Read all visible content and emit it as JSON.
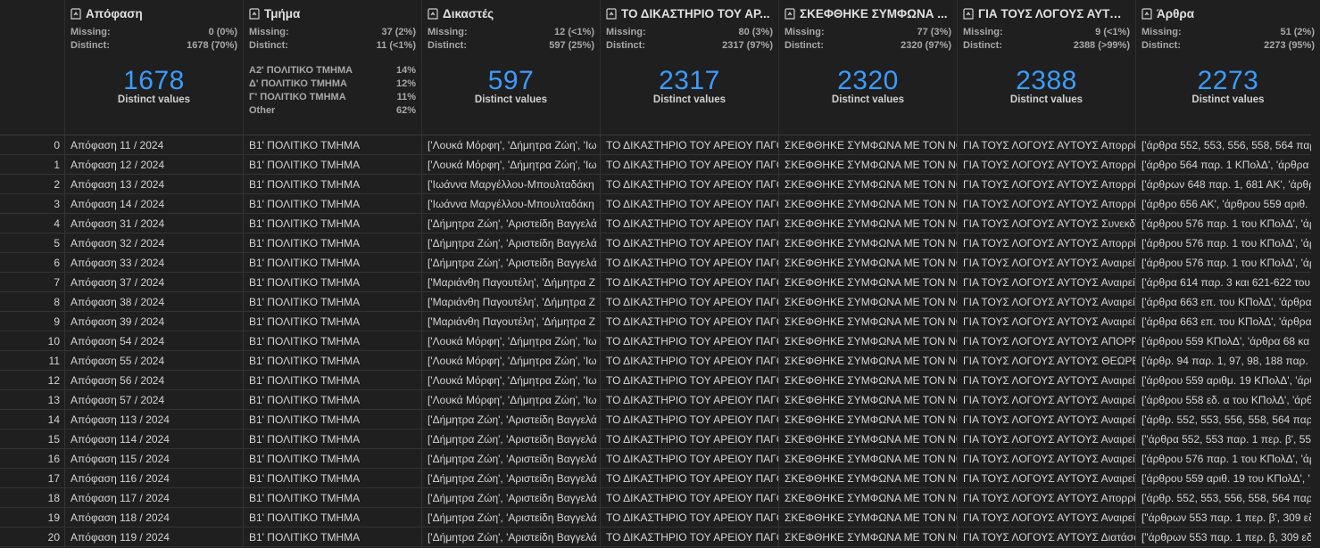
{
  "columns": [
    {
      "name": "Απόφαση",
      "icon": "text-type-icon",
      "missing_label": "Missing:",
      "missing_value": "0 (0%)",
      "distinct_label": "Distinct:",
      "distinct_value": "1678 (70%)",
      "summary_type": "distinct",
      "distinct_count": "1678",
      "distinct_caption": "Distinct values"
    },
    {
      "name": "Τμήμα",
      "icon": "text-type-icon",
      "missing_label": "Missing:",
      "missing_value": "37 (2%)",
      "distinct_label": "Distinct:",
      "distinct_value": "11 (<1%)",
      "summary_type": "categories",
      "categories": [
        {
          "label": "Α2' ΠΟΛΙΤΙΚΟ ΤΜΗΜΑ",
          "pct": "14%"
        },
        {
          "label": "Δ' ΠΟΛΙΤΙΚΟ ΤΜΗΜΑ",
          "pct": "12%"
        },
        {
          "label": "Γ' ΠΟΛΙΤΙΚΟ ΤΜΗΜΑ",
          "pct": "11%"
        },
        {
          "label": "Other",
          "pct": "62%"
        }
      ]
    },
    {
      "name": "Δικαστές",
      "icon": "text-type-icon",
      "missing_label": "Missing:",
      "missing_value": "12 (<1%)",
      "distinct_label": "Distinct:",
      "distinct_value": "597 (25%)",
      "summary_type": "distinct",
      "distinct_count": "597",
      "distinct_caption": "Distinct values"
    },
    {
      "name": "ΤΟ ΔΙΚΑΣΤΗΡΙΟ ΤΟΥ ΑΡ...",
      "icon": "text-type-icon",
      "missing_label": "Missing:",
      "missing_value": "80 (3%)",
      "distinct_label": "Distinct:",
      "distinct_value": "2317 (97%)",
      "summary_type": "distinct",
      "distinct_count": "2317",
      "distinct_caption": "Distinct values"
    },
    {
      "name": "ΣΚΕΦΘΗΚΕ ΣΥΜΦΩΝΑ ...",
      "icon": "text-type-icon",
      "missing_label": "Missing:",
      "missing_value": "77 (3%)",
      "distinct_label": "Distinct:",
      "distinct_value": "2320 (97%)",
      "summary_type": "distinct",
      "distinct_count": "2320",
      "distinct_caption": "Distinct values"
    },
    {
      "name": "ΓΙΑ ΤΟΥΣ ΛΟΓΟΥΣ ΑΥΤΟΥΣ",
      "icon": "text-type-icon",
      "missing_label": "Missing:",
      "missing_value": "9 (<1%)",
      "distinct_label": "Distinct:",
      "distinct_value": "2388 (>99%)",
      "summary_type": "distinct",
      "distinct_count": "2388",
      "distinct_caption": "Distinct values"
    },
    {
      "name": "Άρθρα",
      "icon": "text-type-icon",
      "missing_label": "Missing:",
      "missing_value": "51 (2%)",
      "distinct_label": "Distinct:",
      "distinct_value": "2273 (95%)",
      "summary_type": "distinct",
      "distinct_count": "2273",
      "distinct_caption": "Distinct values"
    }
  ],
  "rows": [
    {
      "idx": "0",
      "c": [
        "Απόφαση 11 / 2024",
        "Β1' ΠΟΛΙΤΙΚΟ ΤΜΗΜΑ",
        "['Λουκά Μόρφη', 'Δήμητρα Ζώη', 'Ιω",
        "ΤΟ ΔΙΚΑΣΤΗΡΙΟ ΤΟΥ ΑΡΕΙΟΥ ΠΑΓΟΥ",
        "ΣΚΕΦΘΗΚΕ ΣΥΜΦΩΝΑ ΜΕ ΤΟΝ ΝΟΜ",
        "ΓΙΑ ΤΟΥΣ ΛΟΓΟΥΣ ΑΥΤΟΥΣ Απορρίπ",
        "['άρθρα 552, 553, 556, 558, 564 παρ"
      ]
    },
    {
      "idx": "1",
      "c": [
        "Απόφαση 12 / 2024",
        "Β1' ΠΟΛΙΤΙΚΟ ΤΜΗΜΑ",
        "['Λουκά Μόρφη', 'Δήμητρα Ζώη', 'Ιω",
        "ΤΟ ΔΙΚΑΣΤΗΡΙΟ ΤΟΥ ΑΡΕΙΟΥ ΠΑΓΟΥ",
        "ΣΚΕΦΘΗΚΕ ΣΥΜΦΩΝΑ ΜΕ ΤΟΝ ΝΟΜ",
        "ΓΙΑ ΤΟΥΣ ΛΟΓΟΥΣ ΑΥΤΟΥΣ Απορρίπ",
        "['άρθρο 564 παρ. 1 ΚΠολΔ', 'άρθρα"
      ]
    },
    {
      "idx": "2",
      "c": [
        "Απόφαση 13 / 2024",
        "Β1' ΠΟΛΙΤΙΚΟ ΤΜΗΜΑ",
        "['Ιωάννα Μαργέλλου-Μπουλταδάκη",
        "ΤΟ ΔΙΚΑΣΤΗΡΙΟ ΤΟΥ ΑΡΕΙΟΥ ΠΑΓΟΥ",
        "ΣΚΕΦΘΗΚΕ ΣΥΜΦΩΝΑ ΜΕ ΤΟΝ ΝΟΜ",
        "ΓΙΑ ΤΟΥΣ ΛΟΓΟΥΣ ΑΥΤΟΥΣ Απορρίπ",
        "['άρθρων 648 παρ. 1, 681 ΑΚ', 'άρθρ"
      ]
    },
    {
      "idx": "3",
      "c": [
        "Απόφαση 14 / 2024",
        "Β1' ΠΟΛΙΤΙΚΟ ΤΜΗΜΑ",
        "['Ιωάννα Μαργέλλου-Μπουλταδάκη",
        "ΤΟ ΔΙΚΑΣΤΗΡΙΟ ΤΟΥ ΑΡΕΙΟΥ ΠΑΓΟΥ",
        "ΣΚΕΦΘΗΚΕ ΣΥΜΦΩΝΑ ΜΕ ΤΟΝ ΝΟΜ",
        "ΓΙΑ ΤΟΥΣ ΛΟΓΟΥΣ ΑΥΤΟΥΣ Απορρίπ",
        "['άρθρο 656 ΑΚ', 'άρθρου 559 αριθ."
      ]
    },
    {
      "idx": "4",
      "c": [
        "Απόφαση 31 / 2024",
        "Β1' ΠΟΛΙΤΙΚΟ ΤΜΗΜΑ",
        "['Δήμητρα Ζώη', 'Αριστείδη Βαγγελά",
        "ΤΟ ΔΙΚΑΣΤΗΡΙΟ ΤΟΥ ΑΡΕΙΟΥ ΠΑΓΟΥ",
        "ΣΚΕΦΘΗΚΕ ΣΥΜΦΩΝΑ ΜΕ ΤΟΝ ΝΟΜ",
        "ΓΙΑ ΤΟΥΣ ΛΟΓΟΥΣ ΑΥΤΟΥΣ Συνεκδικ",
        "['άρθρου 576 παρ. 1 του ΚΠολΔ', 'άρ"
      ]
    },
    {
      "idx": "5",
      "c": [
        "Απόφαση 32 / 2024",
        "Β1' ΠΟΛΙΤΙΚΟ ΤΜΗΜΑ",
        "['Δήμητρα Ζώη', 'Αριστείδη Βαγγελά",
        "ΤΟ ΔΙΚΑΣΤΗΡΙΟ ΤΟΥ ΑΡΕΙΟΥ ΠΑΓΟΥ",
        "ΣΚΕΦΘΗΚΕ ΣΥΜΦΩΝΑ ΜΕ ΤΟΝ ΝΟΜ",
        "ΓΙΑ ΤΟΥΣ ΛΟΓΟΥΣ ΑΥΤΟΥΣ Απορρίπ",
        "['άρθρου 576 παρ. 1 του ΚΠολΔ', 'άρ"
      ]
    },
    {
      "idx": "6",
      "c": [
        "Απόφαση 33 / 2024",
        "Β1' ΠΟΛΙΤΙΚΟ ΤΜΗΜΑ",
        "['Δήμητρα Ζώη', 'Αριστείδη Βαγγελά",
        "ΤΟ ΔΙΚΑΣΤΗΡΙΟ ΤΟΥ ΑΡΕΙΟΥ ΠΑΓΟΥ",
        "ΣΚΕΦΘΗΚΕ ΣΥΜΦΩΝΑ ΜΕ ΤΟΝ ΝΟΜ",
        "ΓΙΑ ΤΟΥΣ ΛΟΓΟΥΣ ΑΥΤΟΥΣ Αναιρεί τ",
        "['άρθρου 576 παρ. 1 του ΚΠολΔ', 'άρ"
      ]
    },
    {
      "idx": "7",
      "c": [
        "Απόφαση 37 / 2024",
        "Β1' ΠΟΛΙΤΙΚΟ ΤΜΗΜΑ",
        "['Μαριάνθη Παγουτέλη', 'Δήμητρα Ζ",
        "ΤΟ ΔΙΚΑΣΤΗΡΙΟ ΤΟΥ ΑΡΕΙΟΥ ΠΑΓΟΥ",
        "ΣΚΕΦΘΗΚΕ ΣΥΜΦΩΝΑ ΜΕ ΤΟΝ ΝΟΜ",
        "ΓΙΑ ΤΟΥΣ ΛΟΓΟΥΣ ΑΥΤΟΥΣ Αναιρεί τ",
        "['άρθρα 614 παρ. 3 και 621-622 του"
      ]
    },
    {
      "idx": "8",
      "c": [
        "Απόφαση 38 / 2024",
        "Β1' ΠΟΛΙΤΙΚΟ ΤΜΗΜΑ",
        "['Μαριάνθη Παγουτέλη', 'Δήμητρα Ζ",
        "ΤΟ ΔΙΚΑΣΤΗΡΙΟ ΤΟΥ ΑΡΕΙΟΥ ΠΑΓΟΥ",
        "ΣΚΕΦΘΗΚΕ ΣΥΜΦΩΝΑ ΜΕ ΤΟΝ ΝΟΜ",
        "ΓΙΑ ΤΟΥΣ ΛΟΓΟΥΣ ΑΥΤΟΥΣ Αναιρεί, ε",
        "['άρθρα 663 επ. του ΚΠολΔ', 'άρθρα"
      ]
    },
    {
      "idx": "9",
      "c": [
        "Απόφαση 39 / 2024",
        "Β1' ΠΟΛΙΤΙΚΟ ΤΜΗΜΑ",
        "['Μαριάνθη Παγουτέλη', 'Δήμητρα Ζ",
        "ΤΟ ΔΙΚΑΣΤΗΡΙΟ ΤΟΥ ΑΡΕΙΟΥ ΠΑΓΟΥ",
        "ΣΚΕΦΘΗΚΕ ΣΥΜΦΩΝΑ ΜΕ ΤΟΝ ΝΟΜ",
        "ΓΙΑ ΤΟΥΣ ΛΟΓΟΥΣ ΑΥΤΟΥΣ Αναιρεί, ε",
        "['άρθρα 663 επ. του ΚΠολΔ', 'άρθρα"
      ]
    },
    {
      "idx": "10",
      "c": [
        "Απόφαση 54 / 2024",
        "Β1' ΠΟΛΙΤΙΚΟ ΤΜΗΜΑ",
        "['Λουκά Μόρφη', 'Δήμητρα Ζώη', 'Ιω",
        "ΤΟ ΔΙΚΑΣΤΗΡΙΟ ΤΟΥ ΑΡΕΙΟΥ ΠΑΓΟΥ",
        "ΣΚΕΦΘΗΚΕ ΣΥΜΦΩΝΑ ΜΕ ΤΟΝ ΝΟΜ",
        "ΓΙΑ ΤΟΥΣ ΛΟΓΟΥΣ ΑΥΤΟΥΣ ΑΠΟΡΡΙΠ",
        "['άρθρου 559 ΚΠολΔ', 'άρθρα 68 κα"
      ]
    },
    {
      "idx": "11",
      "c": [
        "Απόφαση 55 / 2024",
        "Β1' ΠΟΛΙΤΙΚΟ ΤΜΗΜΑ",
        "['Λουκά Μόρφη', 'Δήμητρα Ζώη', 'Ιω",
        "ΤΟ ΔΙΚΑΣΤΗΡΙΟ ΤΟΥ ΑΡΕΙΟΥ ΠΑΓΟΥ",
        "ΣΚΕΦΘΗΚΕ ΣΥΜΦΩΝΑ ΜΕ ΤΟΝ ΝΟΜ",
        "ΓΙΑ ΤΟΥΣ ΛΟΓΟΥΣ ΑΥΤΟΥΣ ΘΕΩΡΕΙ α",
        "['άρθρ. 94 παρ. 1, 97, 98, 188 παρ. 1"
      ]
    },
    {
      "idx": "12",
      "c": [
        "Απόφαση 56 / 2024",
        "Β1' ΠΟΛΙΤΙΚΟ ΤΜΗΜΑ",
        "['Λουκά Μόρφη', 'Δήμητρα Ζώη', 'Ιω",
        "ΤΟ ΔΙΚΑΣΤΗΡΙΟ ΤΟΥ ΑΡΕΙΟΥ ΠΑΓΟΥ",
        "ΣΚΕΦΘΗΚΕ ΣΥΜΦΩΝΑ ΜΕ ΤΟΝ ΝΟΜ",
        "ΓΙΑ ΤΟΥΣ ΛΟΓΟΥΣ ΑΥΤΟΥΣ Αναιρεί α",
        "['άρθρου 559 αριθμ. 19 ΚΠολΔ', 'άρθ"
      ]
    },
    {
      "idx": "13",
      "c": [
        "Απόφαση 57 / 2024",
        "Β1' ΠΟΛΙΤΙΚΟ ΤΜΗΜΑ",
        "['Λουκά Μόρφη', 'Δήμητρα Ζώη', 'Ιω",
        "ΤΟ ΔΙΚΑΣΤΗΡΙΟ ΤΟΥ ΑΡΕΙΟΥ ΠΑΓΟΥ",
        "ΣΚΕΦΘΗΚΕ ΣΥΜΦΩΝΑ ΜΕ ΤΟΝ ΝΟΜ",
        "ΓΙΑ ΤΟΥΣ ΛΟΓΟΥΣ ΑΥΤΟΥΣ Αναιρεί τ",
        "['άρθρου 558 εδ. α του ΚΠολΔ', 'άρθ"
      ]
    },
    {
      "idx": "14",
      "c": [
        "Απόφαση 113 / 2024",
        "Β1' ΠΟΛΙΤΙΚΟ ΤΜΗΜΑ",
        "['Δήμητρα Ζώη', 'Αριστείδη Βαγγελά",
        "ΤΟ ΔΙΚΑΣΤΗΡΙΟ ΤΟΥ ΑΡΕΙΟΥ ΠΑΓΟΥ",
        "ΣΚΕΦΘΗΚΕ ΣΥΜΦΩΝΑ ΜΕ ΤΟΝ ΝΟΜ",
        "ΓΙΑ ΤΟΥΣ ΛΟΓΟΥΣ ΑΥΤΟΥΣ Αναιρεί τ",
        "['άρθρ. 552, 553, 556, 558, 564 παρ."
      ]
    },
    {
      "idx": "15",
      "c": [
        "Απόφαση 114 / 2024",
        "Β1' ΠΟΛΙΤΙΚΟ ΤΜΗΜΑ",
        "['Δήμητρα Ζώη', 'Αριστείδη Βαγγελά",
        "ΤΟ ΔΙΚΑΣΤΗΡΙΟ ΤΟΥ ΑΡΕΙΟΥ ΠΑΓΟΥ",
        "ΣΚΕΦΘΗΚΕ ΣΥΜΦΩΝΑ ΜΕ ΤΟΝ ΝΟΜ",
        "ΓΙΑ ΤΟΥΣ ΛΟΓΟΥΣ ΑΥΤΟΥΣ Αναιρεί τ",
        "[\"άρθρα 552, 553 παρ. 1 περ. β', 559"
      ]
    },
    {
      "idx": "16",
      "c": [
        "Απόφαση 115 / 2024",
        "Β1' ΠΟΛΙΤΙΚΟ ΤΜΗΜΑ",
        "['Δήμητρα Ζώη', 'Αριστείδη Βαγγελά",
        "ΤΟ ΔΙΚΑΣΤΗΡΙΟ ΤΟΥ ΑΡΕΙΟΥ ΠΑΓΟΥ",
        "ΣΚΕΦΘΗΚΕ ΣΥΜΦΩΝΑ ΜΕ ΤΟΝ ΝΟΜ",
        "ΓΙΑ ΤΟΥΣ ΛΟΓΟΥΣ ΑΥΤΟΥΣ Αναιρεί τ",
        "['άρθρου 576 παρ. 1 του ΚΠολΔ', 'άρ"
      ]
    },
    {
      "idx": "17",
      "c": [
        "Απόφαση 116 / 2024",
        "Β1' ΠΟΛΙΤΙΚΟ ΤΜΗΜΑ",
        "['Δήμητρα Ζώη', 'Αριστείδη Βαγγελά",
        "ΤΟ ΔΙΚΑΣΤΗΡΙΟ ΤΟΥ ΑΡΕΙΟΥ ΠΑΓΟΥ",
        "ΣΚΕΦΘΗΚΕ ΣΥΜΦΩΝΑ ΜΕ ΤΟΝ ΝΟΜ",
        "ΓΙΑ ΤΟΥΣ ΛΟΓΟΥΣ ΑΥΤΟΥΣ Αναιρεί τ",
        "['άρθρου 559 αριθ. 19 του ΚΠολΔ', '"
      ]
    },
    {
      "idx": "18",
      "c": [
        "Απόφαση 117 / 2024",
        "Β1' ΠΟΛΙΤΙΚΟ ΤΜΗΜΑ",
        "['Δήμητρα Ζώη', 'Αριστείδη Βαγγελά",
        "ΤΟ ΔΙΚΑΣΤΗΡΙΟ ΤΟΥ ΑΡΕΙΟΥ ΠΑΓΟΥ",
        "ΣΚΕΦΘΗΚΕ ΣΥΜΦΩΝΑ ΜΕ ΤΟΝ ΝΟΜ",
        "ΓΙΑ ΤΟΥΣ ΛΟΓΟΥΣ ΑΥΤΟΥΣ Απορρίπ",
        "['άρθρ. 552, 553, 556, 558, 564 παρ.3"
      ]
    },
    {
      "idx": "19",
      "c": [
        "Απόφαση 118 / 2024",
        "Β1' ΠΟΛΙΤΙΚΟ ΤΜΗΜΑ",
        "['Δήμητρα Ζώη', 'Αριστείδη Βαγγελά",
        "ΤΟ ΔΙΚΑΣΤΗΡΙΟ ΤΟΥ ΑΡΕΙΟΥ ΠΑΓΟΥ",
        "ΣΚΕΦΘΗΚΕ ΣΥΜΦΩΝΑ ΜΕ ΤΟΝ ΝΟΜ",
        "ΓΙΑ ΤΟΥΣ ΛΟΓΟΥΣ ΑΥΤΟΥΣ Αναιρεί τ",
        "[\"άρθρων 553 παρ. 1 περ. β', 309 εδ"
      ]
    },
    {
      "idx": "20",
      "c": [
        "Απόφαση 119 / 2024",
        "Β1' ΠΟΛΙΤΙΚΟ ΤΜΗΜΑ",
        "['Δήμητρα Ζώη', 'Αριστείδη Βαγγελά",
        "ΤΟ ΔΙΚΑΣΤΗΡΙΟ ΤΟΥ ΑΡΕΙΟΥ ΠΑΓΟΥ",
        "ΣΚΕΦΘΗΚΕ ΣΥΜΦΩΝΑ ΜΕ ΤΟΝ ΝΟΜ",
        "ΓΙΑ ΤΟΥΣ ΛΟΓΟΥΣ ΑΥΤΟΥΣ Διατάσσε",
        "[\"άρθρων 553 παρ. 1 περ. β, 309 εδ."
      ]
    }
  ],
  "colors": {
    "background": "#1f1f1f",
    "accent_number": "#3b9cff",
    "text": "#d4d4d4",
    "muted": "#a8a8a8"
  }
}
